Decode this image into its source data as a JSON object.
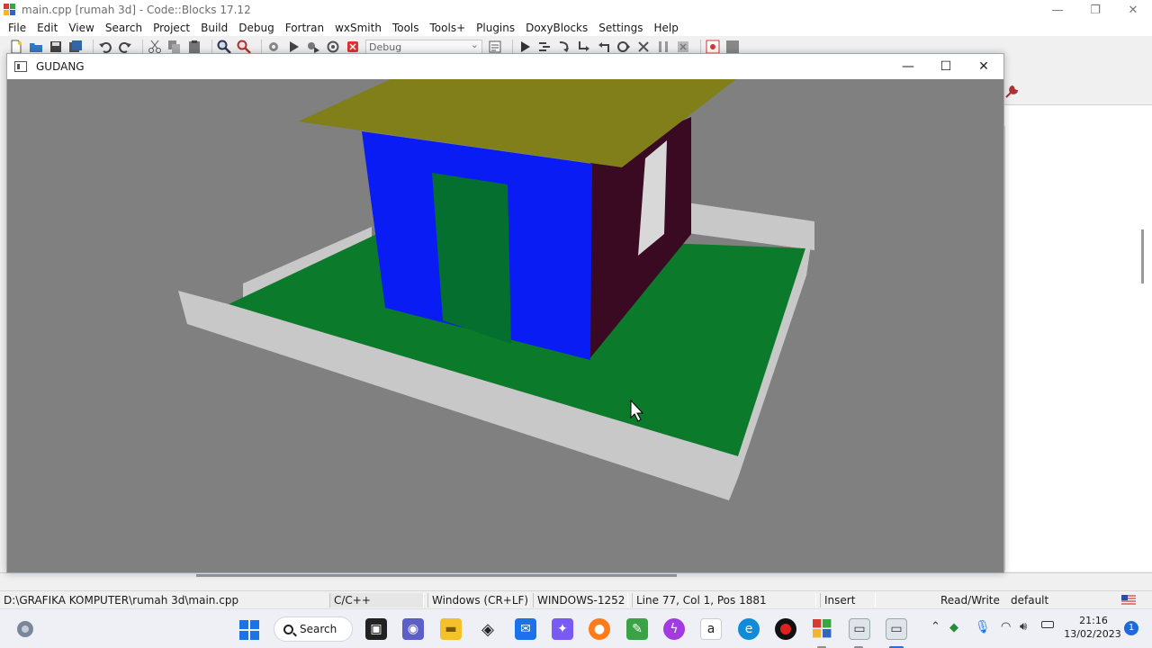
{
  "ide": {
    "title": "main.cpp [rumah 3d] - Code::Blocks 17.12",
    "menu": [
      "File",
      "Edit",
      "View",
      "Search",
      "Project",
      "Build",
      "Debug",
      "Fortran",
      "wxSmith",
      "Tools",
      "Tools+",
      "Plugins",
      "DoxyBlocks",
      "Settings",
      "Help"
    ],
    "build_target": "Debug",
    "status": {
      "path": "D:\\GRAFIKA KOMPUTER\\rumah 3d\\main.cpp",
      "language": "C/C++",
      "eol": "Windows (CR+LF)",
      "encoding": "WINDOWS-1252",
      "position": "Line 77, Col 1, Pos 1881",
      "mode": "Insert",
      "access": "Read/Write",
      "theme": "default"
    }
  },
  "gl_window": {
    "title": "GUDANG",
    "scene_colors": {
      "background": "#808080",
      "roof": "#807f1a",
      "front_wall": "#0a1cf4",
      "door": "#046f2f",
      "side_wall": "#3a0922",
      "window": "#d8d8d8",
      "floor": "#0b7a2a",
      "fence": "#c8c8c8"
    }
  },
  "taskbar": {
    "search_label": "Search",
    "time": "21:16",
    "date": "13/02/2023",
    "notification_count": "1"
  }
}
